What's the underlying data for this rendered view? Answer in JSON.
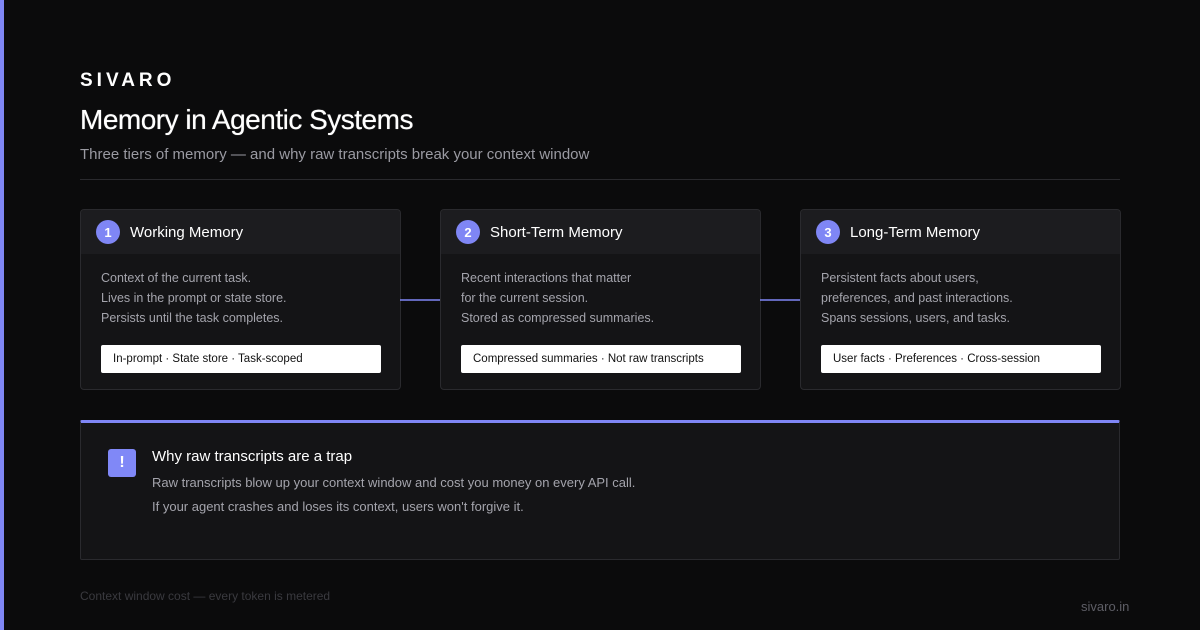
{
  "brand": "SIVARO",
  "title": "Memory in Agentic Systems",
  "subtitle": "Three tiers of memory — and why raw transcripts break your context window",
  "tiers": [
    {
      "number": "1",
      "title": "Working Memory",
      "lines": [
        "Context of the current task.",
        "Lives in the prompt or state store.",
        "Persists until the task completes."
      ],
      "tags": "In-prompt · State store · Task-scoped"
    },
    {
      "number": "2",
      "title": "Short-Term Memory",
      "lines": [
        "Recent interactions that matter",
        "for the current session.",
        "Stored as compressed summaries."
      ],
      "tags": "Compressed summaries · Not raw transcripts"
    },
    {
      "number": "3",
      "title": "Long-Term Memory",
      "lines": [
        "Persistent facts about users,",
        "preferences, and past interactions.",
        "Spans sessions, users, and tasks."
      ],
      "tags": "User facts · Preferences · Cross-session"
    }
  ],
  "callout": {
    "icon": "!",
    "title": "Why raw transcripts are a trap",
    "line1": "Raw transcripts blow up your context window and cost you money on every API call.",
    "line2": "If your agent crashes and loses its context, users won't forgive it."
  },
  "footnote": "Context window cost — every token is metered",
  "domain": "sivaro.in",
  "colors": {
    "accent": "#7f86f5",
    "background": "#0b0b0c",
    "card": "#141416"
  }
}
